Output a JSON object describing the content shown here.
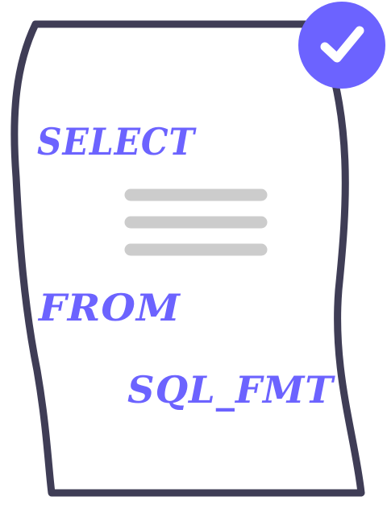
{
  "logo": {
    "keywords": [
      "SELECT",
      "FROM",
      "SQL_FMT"
    ],
    "text_color": "#6c63ff",
    "outline_color": "#3f3d56",
    "placeholder_line_color": "#cccccc",
    "badge_color": "#6c63ff",
    "badge_icon": "checkmark-icon",
    "document_icon": "scroll-document-icon"
  }
}
